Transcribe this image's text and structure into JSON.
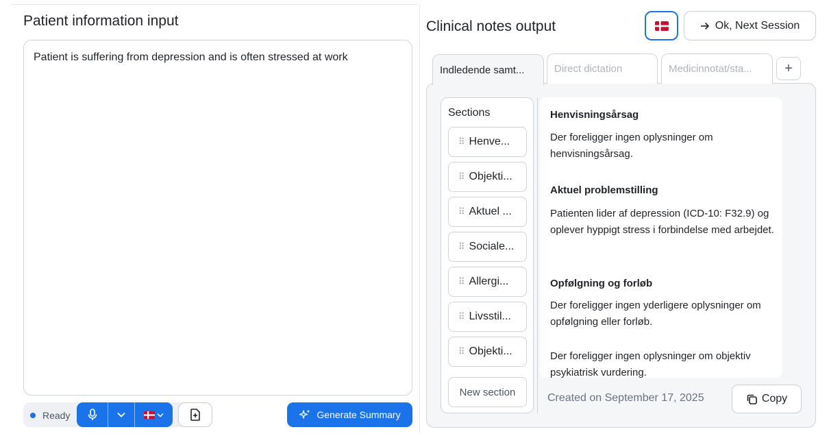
{
  "left": {
    "title": "Patient information input",
    "input_value": "Patient is suffering from depression and is often stressed at work",
    "status": "Ready",
    "generate_label": "Generate Summary"
  },
  "right": {
    "title": "Clinical notes output",
    "next_label": "Ok, Next Session",
    "tabs": [
      {
        "label": "Indledende samt..."
      },
      {
        "label": "Direct dictation"
      },
      {
        "label": "Medicinnotat/sta..."
      }
    ],
    "add_tab_label": "+",
    "sections_title": "Sections",
    "sections": [
      {
        "label": "Henve..."
      },
      {
        "label": "Objekti..."
      },
      {
        "label": "Aktuel ..."
      },
      {
        "label": "Sociale..."
      },
      {
        "label": "Allergi..."
      },
      {
        "label": "Livsstil..."
      },
      {
        "label": "Objekti..."
      }
    ],
    "new_section_label": "New section",
    "content": {
      "h1": "Henvisningsårsag",
      "p1": "Der foreligger ingen oplysninger om henvisningsårsag.",
      "h2": "Aktuel problemstilling",
      "p2": "Patienten lider af depression (ICD-10: F32.9) og oplever hyppigt stress i forbindelse med arbejdet.",
      "h3": "Opfølgning og forløb",
      "p3": "Der foreligger ingen yderligere oplysninger om opfølgning eller forløb.",
      "p4": "Der foreligger ingen oplysninger om objektiv psykiatrisk vurdering."
    },
    "created": "Created on September 17, 2025",
    "copy_label": "Copy"
  },
  "colors": {
    "accent": "#1a73e8",
    "flag_red": "#c8102e"
  }
}
